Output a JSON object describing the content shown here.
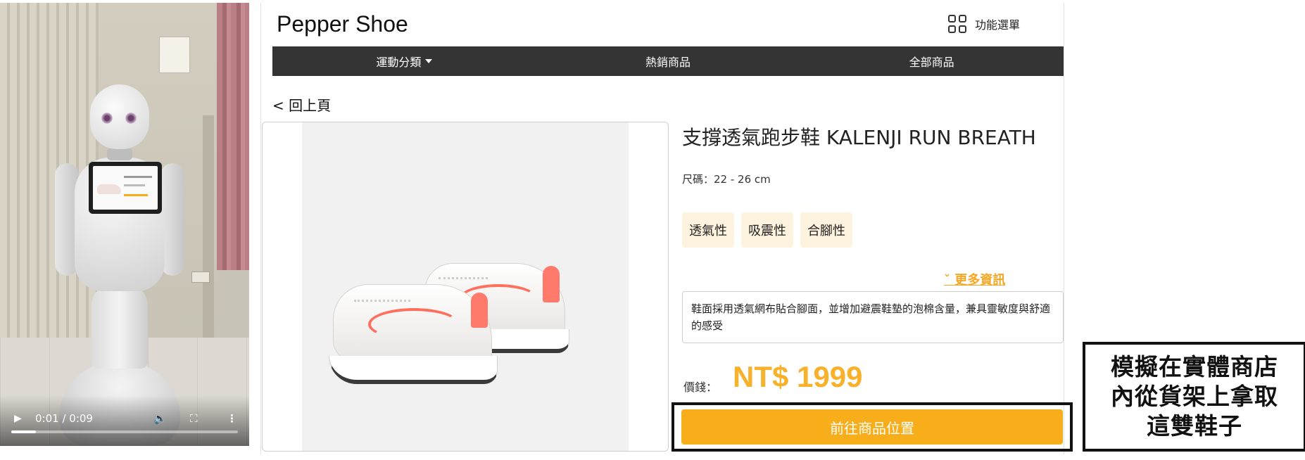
{
  "video": {
    "time_display": "0:01 / 0:09",
    "progress": 0.11,
    "controls": {
      "play_icon": "play-icon",
      "volume_icon": "volume-icon",
      "fullscreen_icon": "fullscreen-icon",
      "more_icon": "more-vertical-icon"
    }
  },
  "header": {
    "brand": "Pepper Shoe",
    "menu_label": "功能選單",
    "menu_icon": "grid-icon"
  },
  "nav": {
    "items": [
      {
        "label": "運動分類",
        "has_dropdown": true
      },
      {
        "label": "熱銷商品"
      },
      {
        "label": "全部商品"
      }
    ]
  },
  "back_label": "< 回上頁",
  "product": {
    "title": "支撐透氣跑步鞋 KALENJI RUN BREATH",
    "size": "尺碼：22 - 26 cm",
    "tags": [
      "透氣性",
      "吸震性",
      "合腳性"
    ],
    "more_info": "ˇ 更多資訊",
    "description": "鞋面採用透氣網布貼合腳面，並增加避震鞋墊的泡棉含量，兼具靈敏度與舒適的感受",
    "price_label": "價錢：",
    "price": "NT$ 1999",
    "cta_label": "前往商品位置"
  },
  "caption": {
    "lines": [
      "模擬在實體商店",
      "內從貨架上拿取",
      "這雙鞋子"
    ]
  },
  "colors": {
    "nav_bg": "#343434",
    "accent": "#f8ad1a",
    "price": "#f8b12a",
    "tag_bg": "#fdf3df",
    "link": "#f5a623"
  }
}
